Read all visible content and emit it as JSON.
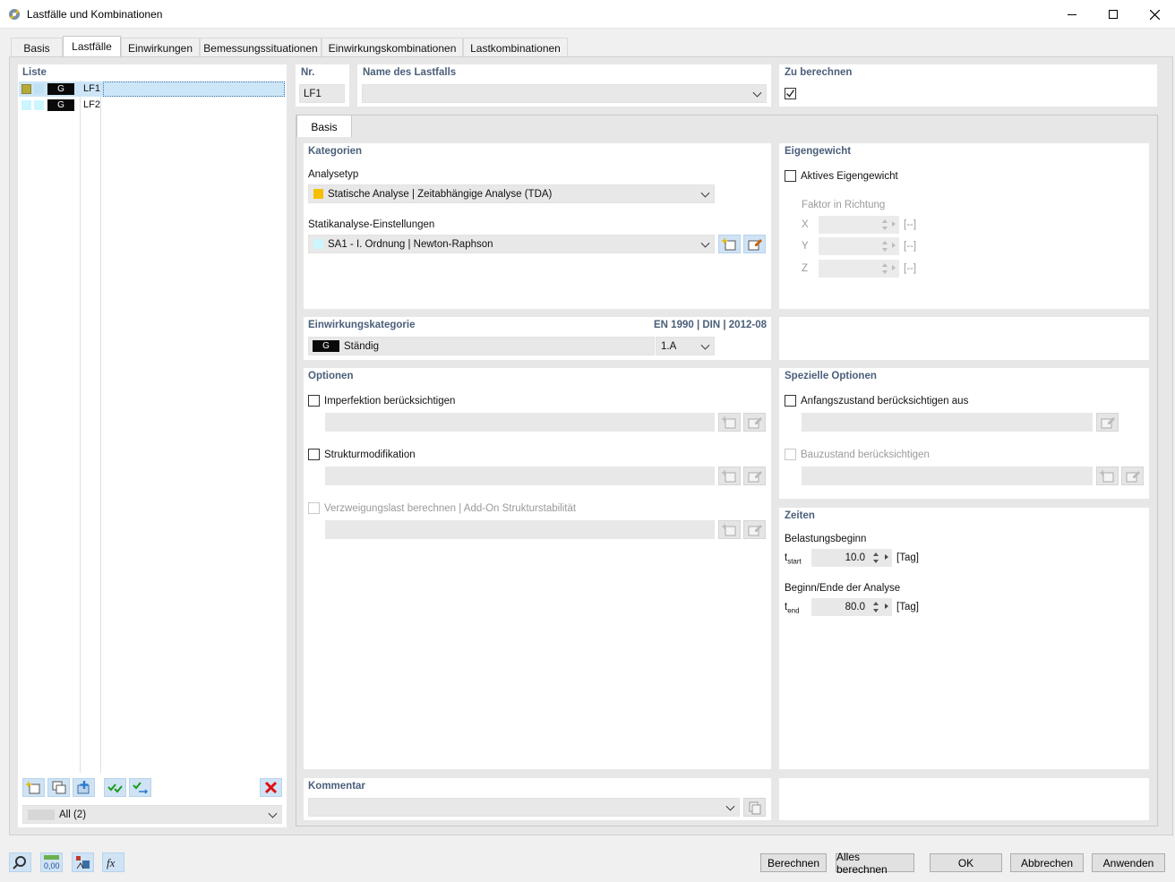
{
  "window": {
    "title": "Lastfälle und Kombinationen"
  },
  "tabs": [
    "Basis",
    "Lastfälle",
    "Einwirkungen",
    "Bemessungssituationen",
    "Einwirkungskombinationen",
    "Lastkombinationen"
  ],
  "list": {
    "header": "Liste",
    "items": [
      {
        "tag": "G",
        "id": "LF1",
        "color1": "#b5aa3a",
        "color2": "#bfe0f5"
      },
      {
        "tag": "G",
        "id": "LF2",
        "color1": "#ccf6ff",
        "color2": "#ccf6ff"
      }
    ],
    "filter": "All (2)"
  },
  "header_fields": {
    "nr_label": "Nr.",
    "nr_value": "LF1",
    "name_label": "Name des Lastfalls",
    "name_value": "",
    "calc_label": "Zu berechnen",
    "calc_checked": true
  },
  "subtab": "Basis",
  "kategorien": {
    "header": "Kategorien",
    "analysetyp_label": "Analysetyp",
    "analysetyp_value": "Statische Analyse | Zeitabhängige Analyse (TDA)",
    "analysetyp_color": "#f5c000",
    "statik_label": "Statikanalyse-Einstellungen",
    "statik_value": "SA1 - I. Ordnung | Newton-Raphson",
    "statik_color": "#ccf6ff"
  },
  "eigengewicht": {
    "header": "Eigengewicht",
    "active_label": "Aktives Eigengewicht",
    "faktor_label": "Faktor in Richtung",
    "axes": [
      "X",
      "Y",
      "Z"
    ],
    "unit": "[--]"
  },
  "einwirkung": {
    "header": "Einwirkungskategorie",
    "norm": "EN 1990 | DIN | 2012-08",
    "tag": "G",
    "value": "Ständig",
    "code": "1.A"
  },
  "optionen": {
    "header": "Optionen",
    "imperfektion": "Imperfektion berücksichtigen",
    "struktur": "Strukturmodifikation",
    "verzweigung": "Verzweigungslast berechnen | Add-On Strukturstabilität"
  },
  "spezielle": {
    "header": "Spezielle Optionen",
    "anfang": "Anfangszustand berücksichtigen aus",
    "bauzustand": "Bauzustand berücksichtigen"
  },
  "zeiten": {
    "header": "Zeiten",
    "beginn_label": "Belastungsbeginn",
    "t_start_base": "t",
    "t_start_sub": "start",
    "t_start_value": "10.0",
    "ende_label": "Beginn/Ende der Analyse",
    "t_end_base": "t",
    "t_end_sub": "end",
    "t_end_value": "80.0",
    "unit": "[Tag]"
  },
  "kommentar": {
    "header": "Kommentar",
    "value": ""
  },
  "footer": {
    "berechnen": "Berechnen",
    "alles": "Alles berechnen",
    "ok": "OK",
    "abbrechen": "Abbrechen",
    "anwenden": "Anwenden"
  }
}
